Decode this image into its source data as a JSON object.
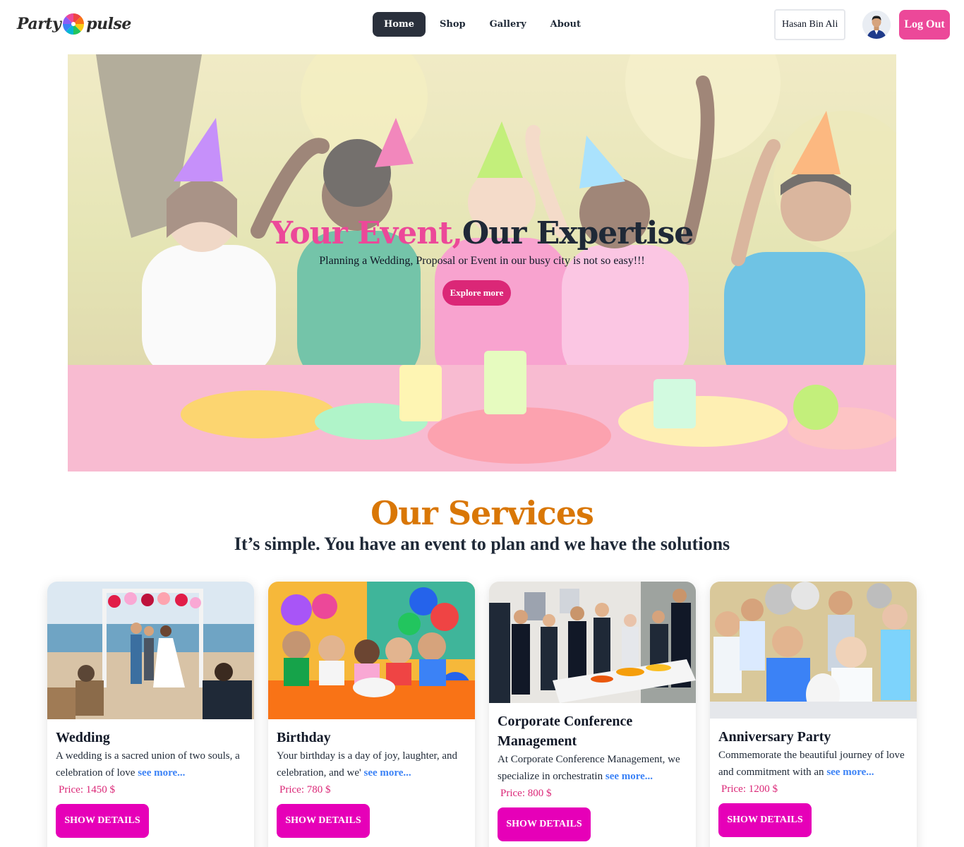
{
  "nav": {
    "logo_left": "Party",
    "logo_right": "pulse",
    "links": [
      "Home",
      "Shop",
      "Gallery",
      "About"
    ],
    "user_name": "Hasan Bin Ali",
    "logout_label": "Log Out"
  },
  "hero": {
    "title_pink": "Your Event,",
    "title_dark": "Our Expertise",
    "subtitle": "Planning a Wedding, Proposal or Event in our busy city is not so easy!!!",
    "button_label": "Explore more"
  },
  "services": {
    "title": "Our Services",
    "subtitle": "It’s simple. You have an event to plan and we have the solutions",
    "cards": [
      {
        "title": "Wedding",
        "description": "A wedding is a sacred union of two souls, a celebration of love",
        "see_more": "see more...",
        "price": "Price: 1450 $",
        "button": "Show Details"
      },
      {
        "title": "Birthday",
        "description": "Your birthday is a day of joy, laughter, and celebration, and we'",
        "see_more": "see more...",
        "price": "Price: 780 $",
        "button": "Show Details"
      },
      {
        "title": "Corporate Conference Management",
        "description": "At Corporate Conference Management, we specialize in orchestratin",
        "see_more": "see more...",
        "price": "Price: 800 $",
        "button": "Show Details"
      },
      {
        "title": "Anniversary Party",
        "description": "Commemorate the beautiful journey of love and commitment with an",
        "see_more": "see more...",
        "price": "Price: 1200 $",
        "button": "Show Details"
      }
    ]
  },
  "colors": {
    "accent_pink": "#ec4899",
    "button_magenta": "#e600b8",
    "services_orange": "#d97706",
    "nav_active": "#2a303c",
    "link_blue": "#3b82f6"
  },
  "icons": [
    "pinwheel-logo-icon",
    "user-avatar-icon"
  ]
}
